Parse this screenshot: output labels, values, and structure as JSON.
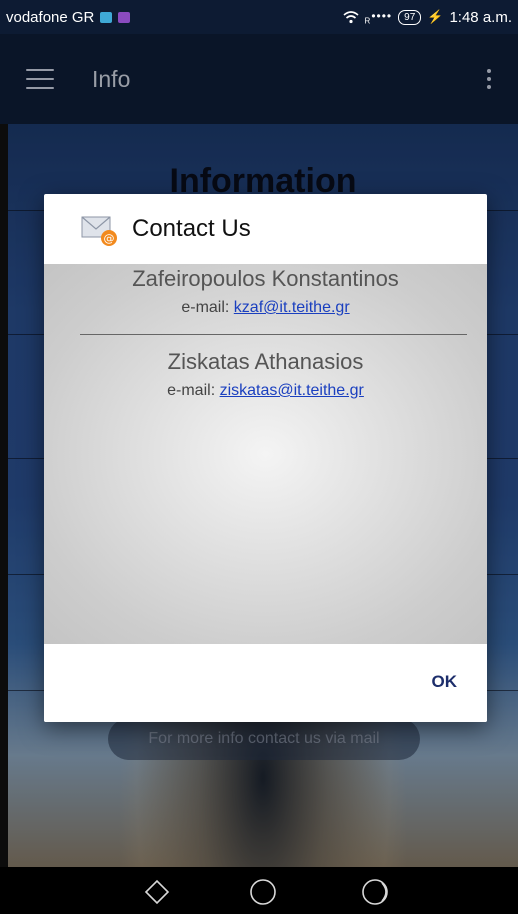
{
  "status_bar": {
    "carrier": "vodafone GR",
    "signal": "R",
    "battery": "97",
    "time": "1:48 a.m."
  },
  "app_bar": {
    "title": "Info"
  },
  "background": {
    "heading": "Information",
    "toast": "For more info contact us via mail"
  },
  "dialog": {
    "title": "Contact Us",
    "contacts": [
      {
        "name": "Zafeiropoulos Konstantinos",
        "email_label": "e-mail: ",
        "email": "kzaf@it.teithe.gr"
      },
      {
        "name": "Ziskatas Athanasios",
        "email_label": "e-mail: ",
        "email": "ziskatas@it.teithe.gr"
      }
    ],
    "ok_label": "OK"
  },
  "colors": {
    "link": "#1a3fbf",
    "button": "#1d2e6b",
    "app_bar": "#0e1e38"
  },
  "icons": [
    "menu-icon",
    "overflow-menu-icon",
    "mail-icon",
    "wifi-icon",
    "battery-icon",
    "back-icon",
    "home-icon",
    "recents-icon"
  ]
}
